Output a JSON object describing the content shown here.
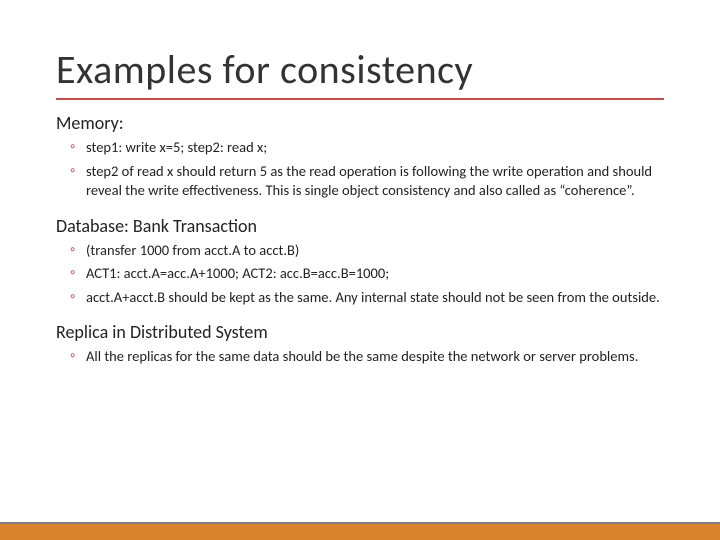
{
  "title": "Examples for consistency",
  "sections": [
    {
      "heading": "Memory:",
      "bullets": [
        "step1: write x=5; step2: read x;",
        "step2 of read x should return 5 as the read operation is following the write operation and should reveal the write effectiveness. This is single object consistency and also called as “coherence”."
      ]
    },
    {
      "heading": "Database: Bank Transaction",
      "bullets": [
        "(transfer 1000 from acct.A to acct.B)",
        "ACT1: acct.A=acc.A+1000; ACT2: acc.B=acc.B=1000;",
        "acct.A+acct.B should be kept as the same. Any internal state should not be seen from the outside."
      ]
    },
    {
      "heading": "Replica in Distributed System",
      "bullets": [
        "All the replicas for the same data should be the same despite the network or server problems."
      ]
    }
  ]
}
